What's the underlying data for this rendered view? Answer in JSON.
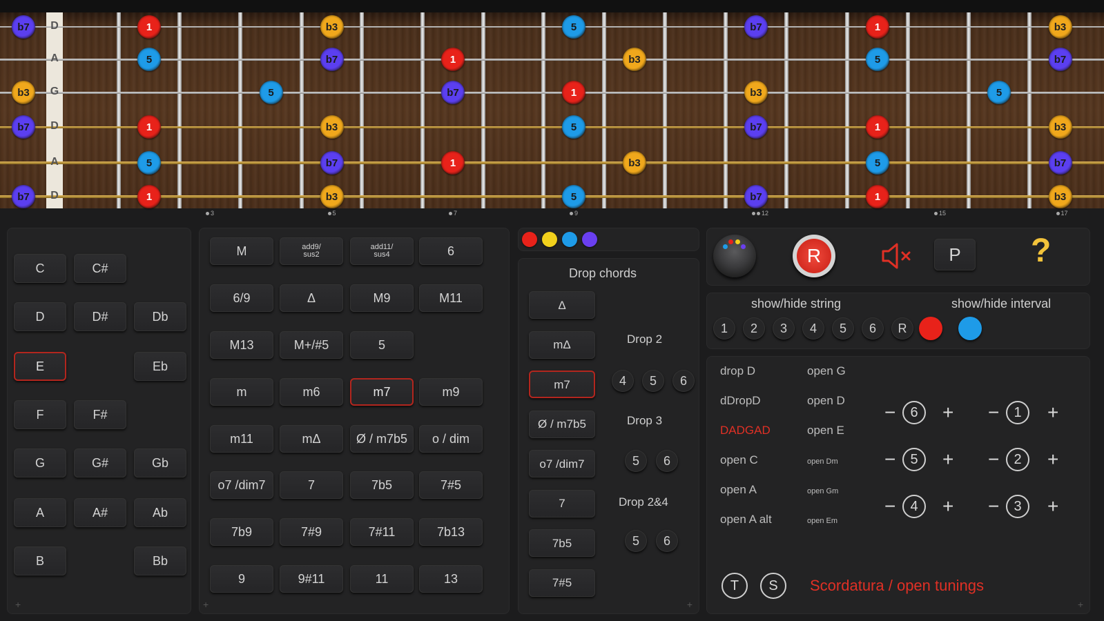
{
  "fretboard": {
    "strings": [
      {
        "open": "D",
        "notes": [
          {
            "fret": 0,
            "label": "b7"
          },
          {
            "fret": 2,
            "label": "1"
          },
          {
            "fret": 5,
            "label": "b3"
          },
          {
            "fret": 9,
            "label": "5"
          },
          {
            "fret": 12,
            "label": "b7"
          },
          {
            "fret": 14,
            "label": "1"
          },
          {
            "fret": 17,
            "label": "b3"
          }
        ]
      },
      {
        "open": "A",
        "notes": [
          {
            "fret": 2,
            "label": "5"
          },
          {
            "fret": 5,
            "label": "b7"
          },
          {
            "fret": 7,
            "label": "1"
          },
          {
            "fret": 10,
            "label": "b3"
          },
          {
            "fret": 14,
            "label": "5"
          },
          {
            "fret": 17,
            "label": "b7"
          }
        ]
      },
      {
        "open": "G",
        "notes": [
          {
            "fret": 0,
            "label": "b3"
          },
          {
            "fret": 4,
            "label": "5"
          },
          {
            "fret": 7,
            "label": "b7"
          },
          {
            "fret": 9,
            "label": "1"
          },
          {
            "fret": 12,
            "label": "b3"
          },
          {
            "fret": 16,
            "label": "5"
          }
        ]
      },
      {
        "open": "D",
        "notes": [
          {
            "fret": 0,
            "label": "b7"
          },
          {
            "fret": 2,
            "label": "1"
          },
          {
            "fret": 5,
            "label": "b3"
          },
          {
            "fret": 9,
            "label": "5"
          },
          {
            "fret": 12,
            "label": "b7"
          },
          {
            "fret": 14,
            "label": "1"
          },
          {
            "fret": 17,
            "label": "b3"
          }
        ]
      },
      {
        "open": "A",
        "notes": [
          {
            "fret": 2,
            "label": "5"
          },
          {
            "fret": 5,
            "label": "b7"
          },
          {
            "fret": 7,
            "label": "1"
          },
          {
            "fret": 10,
            "label": "b3"
          },
          {
            "fret": 14,
            "label": "5"
          },
          {
            "fret": 17,
            "label": "b7"
          }
        ]
      },
      {
        "open": "D",
        "notes": [
          {
            "fret": 0,
            "label": "b7"
          },
          {
            "fret": 2,
            "label": "1"
          },
          {
            "fret": 5,
            "label": "b3"
          },
          {
            "fret": 9,
            "label": "5"
          },
          {
            "fret": 12,
            "label": "b7"
          },
          {
            "fret": 14,
            "label": "1"
          },
          {
            "fret": 17,
            "label": "b3"
          }
        ]
      }
    ],
    "interval_colors": {
      "1": "#e8221a",
      "b3": "#f0a81c",
      "5": "#1e9be8",
      "b7": "#5b3ff0"
    },
    "fret_markers": [
      {
        "fret": 3,
        "label": "3"
      },
      {
        "fret": 5,
        "label": "5"
      },
      {
        "fret": 7,
        "label": "7"
      },
      {
        "fret": 9,
        "label": "9"
      },
      {
        "fret": 12,
        "label": "12"
      },
      {
        "fret": 15,
        "label": "15"
      },
      {
        "fret": 17,
        "label": "17"
      }
    ]
  },
  "roots": {
    "c": "C",
    "csharp": "C#",
    "d": "D",
    "dsharp": "D#",
    "db": "Db",
    "e": "E",
    "eb": "Eb",
    "f": "F",
    "fsharp": "F#",
    "g": "G",
    "gsharp": "G#",
    "gb": "Gb",
    "a": "A",
    "asharp": "A#",
    "ab": "Ab",
    "b": "B",
    "bb": "Bb",
    "selected": "E"
  },
  "chords": {
    "items": [
      "M",
      "add9/\nsus2",
      "add11/\nsus4",
      "6",
      "6/9",
      "Δ",
      "M9",
      "M11",
      "M13",
      "M+/#5",
      "5",
      "",
      "m",
      "m6",
      "m7",
      "m9",
      "m11",
      "mΔ",
      "Ø / m7b5",
      "o / dim",
      "o7 /dim7",
      "7",
      "7b5",
      "7#5",
      "7b9",
      "7#9",
      "7#11",
      "7b13",
      "9",
      "9#11",
      "11",
      "13"
    ],
    "selected": "m7"
  },
  "drop": {
    "title": "Drop chords",
    "chords": [
      "Δ",
      "mΔ",
      "m7",
      "Ø / m7b5",
      "o7 /dim7",
      "7",
      "7b5",
      "7#5"
    ],
    "selected": "m7",
    "drop2": {
      "label": "Drop 2",
      "strings": [
        "4",
        "5",
        "6"
      ]
    },
    "drop3": {
      "label": "Drop 3",
      "strings": [
        "5",
        "6"
      ]
    },
    "drop24": {
      "label": "Drop 2&4",
      "strings": [
        "5",
        "6"
      ]
    }
  },
  "dots_colors": [
    "#e8221a",
    "#f2d11c",
    "#1e9be8",
    "#6a3ff0"
  ],
  "controls": {
    "r_label": "R",
    "p_label": "P",
    "help_label": "?"
  },
  "showhide": {
    "string_label": "show/hide string",
    "interval_label": "show/hide interval",
    "strings": [
      "1",
      "2",
      "3",
      "4",
      "5",
      "6",
      "R"
    ],
    "interval_colors": [
      "#e8221a",
      "#1e9be8"
    ]
  },
  "tunings": {
    "left": [
      "drop D",
      "dDropD",
      "DADGAD",
      "open C",
      "open A",
      "open A alt"
    ],
    "right": [
      "open G",
      "open D",
      "open E",
      "open Dm",
      "open Gm",
      "open Em"
    ],
    "active": "DADGAD",
    "minus": "−",
    "plus": "+",
    "string_rings": [
      "6",
      "1",
      "5",
      "2",
      "4",
      "3"
    ]
  },
  "footer": {
    "t_label": "T",
    "s_label": "S",
    "scordatura": "Scordatura / open tunings"
  },
  "colors": {
    "accent_red": "#e03025",
    "help_yellow": "#f3c33b"
  }
}
